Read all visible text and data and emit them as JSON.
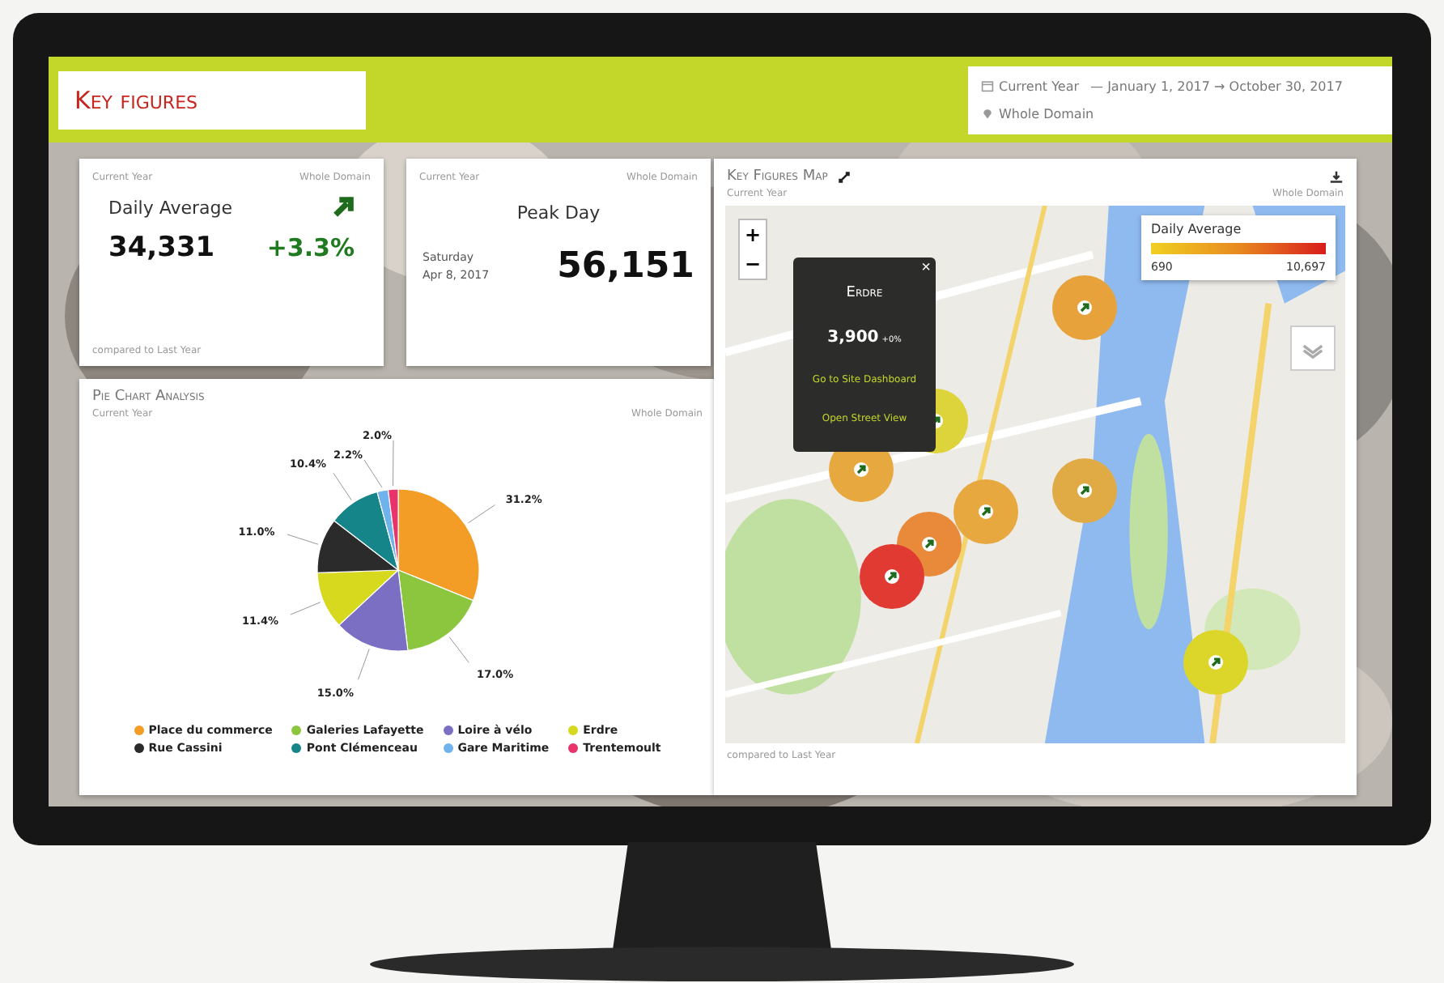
{
  "header": {
    "title": "Key figures",
    "period": "Current Year",
    "range": "— January 1, 2017 → October 30, 2017",
    "scope": "Whole Domain"
  },
  "daily_average": {
    "period": "Current Year",
    "scope": "Whole Domain",
    "title": "Daily Average",
    "value": "34,331",
    "change": "+3.3%",
    "footer": "compared to Last Year"
  },
  "peak_day": {
    "period": "Current Year",
    "scope": "Whole Domain",
    "title": "Peak Day",
    "day": "Saturday",
    "date": "Apr 8, 2017",
    "value": "56,151"
  },
  "pie": {
    "title": "Pie Chart Analysis",
    "period": "Current Year",
    "scope": "Whole Domain",
    "chart_data": {
      "type": "pie",
      "categories": [
        "Place du commerce",
        "Galeries Lafayette",
        "Loire à vélo",
        "Erdre",
        "Rue Cassini",
        "Pont Clémenceau",
        "Gare Maritime",
        "Trentemoult"
      ],
      "values": [
        31.2,
        17.0,
        15.0,
        11.4,
        11.0,
        10.4,
        2.2,
        2.0
      ],
      "value_labels": [
        "31.2%",
        "17.0%",
        "15.0%",
        "11.4%",
        "11.0%",
        "10.4%",
        "2.2%",
        "2.0%"
      ],
      "colors": [
        "#f39c26",
        "#8cc63f",
        "#7b6fc4",
        "#d6d91e",
        "#2b2b2b",
        "#16858a",
        "#6fb2ec",
        "#e8336b"
      ]
    }
  },
  "map": {
    "title": "Key Figures Map",
    "period": "Current Year",
    "scope": "Whole Domain",
    "zoom_in": "+",
    "zoom_out": "−",
    "legend": {
      "title": "Daily Average",
      "min": "690",
      "max": "10,697"
    },
    "popup": {
      "close": "×",
      "title": "Erdre",
      "value": "3,900",
      "change": "+0%",
      "links": [
        "Go to Site Dashboard",
        "Open Street View"
      ]
    },
    "markers": [
      {
        "color": "#e8a23c"
      },
      {
        "color": "#dcd43a"
      },
      {
        "color": "#e8a840"
      },
      {
        "color": "#e8a840"
      },
      {
        "color": "#e98a3a"
      },
      {
        "color": "#e03a32"
      },
      {
        "color": "#e0ab45"
      },
      {
        "color": "#dcd62a"
      }
    ],
    "footer": "compared to Last Year"
  }
}
